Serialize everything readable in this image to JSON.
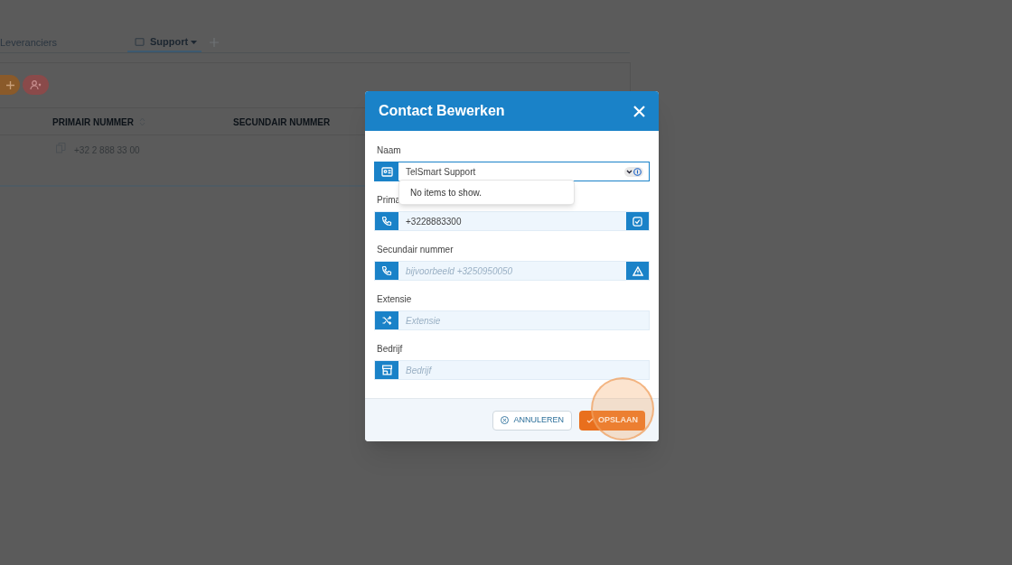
{
  "background": {
    "tabs": [
      {
        "label": "Leveranciers",
        "selected": false
      },
      {
        "label": "Support",
        "selected": true
      }
    ],
    "table": {
      "columns": [
        "PRIMAIR NUMMER",
        "SECUNDAIR NUMMER"
      ],
      "rows": [
        [
          "+32 2 888 33 00",
          ""
        ]
      ]
    }
  },
  "dialog": {
    "title": "Contact Bewerken",
    "fields": [
      {
        "label": "Naam",
        "kind": "name",
        "value": "TelSmart Support"
      },
      {
        "label": "Prima",
        "kind": "verified",
        "value": "+3228883300"
      },
      {
        "label": "Secundair nummer",
        "kind": "unverified",
        "placeholder": "bijvoorbeeld +3250950050"
      },
      {
        "label": "Extensie",
        "kind": "extension",
        "placeholder": "Extensie"
      },
      {
        "label": "Bedrijf",
        "kind": "company",
        "placeholder": "Bedrijf"
      }
    ],
    "dropdown": {
      "message": "No items to show."
    },
    "buttons": [
      {
        "label": "ANNULEREN",
        "kind": "secondary"
      },
      {
        "label": "OPSLAAN",
        "kind": "primary"
      }
    ]
  }
}
